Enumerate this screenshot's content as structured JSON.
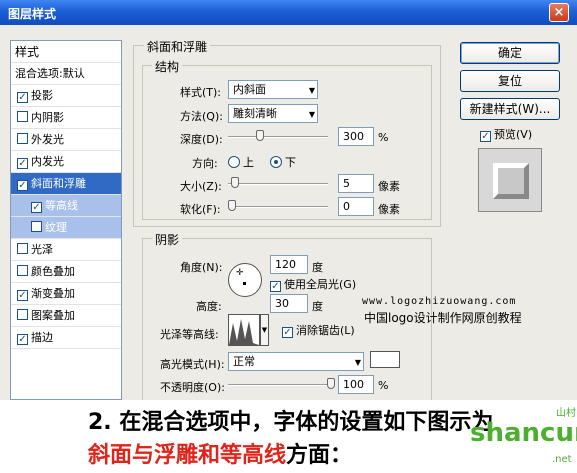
{
  "window": {
    "title": "图层样式",
    "close_glyph": "×"
  },
  "sidebar": {
    "header": "样式",
    "blend": "混合选项:默认",
    "items": [
      {
        "label": "投影",
        "checked": true
      },
      {
        "label": "内阴影",
        "checked": false
      },
      {
        "label": "外发光",
        "checked": false
      },
      {
        "label": "内发光",
        "checked": true
      },
      {
        "label": "斜面和浮雕",
        "checked": true
      },
      {
        "label": "等高线",
        "checked": true
      },
      {
        "label": "纹理",
        "checked": false
      },
      {
        "label": "光泽",
        "checked": false
      },
      {
        "label": "颜色叠加",
        "checked": false
      },
      {
        "label": "渐变叠加",
        "checked": true
      },
      {
        "label": "图案叠加",
        "checked": false
      },
      {
        "label": "描边",
        "checked": true
      }
    ]
  },
  "bevel": {
    "title": "斜面和浮雕",
    "structure_title": "结构",
    "style_label": "样式(T):",
    "style_value": "内斜面",
    "technique_label": "方法(Q):",
    "technique_value": "雕刻清晰",
    "depth_label": "深度(D):",
    "depth_value": "300",
    "depth_unit": "%",
    "depth_level": 0.3,
    "direction_label": "方向:",
    "dir_up": "上",
    "dir_down": "下",
    "size_label": "大小(Z):",
    "size_value": "5",
    "size_unit": "像素",
    "soften_label": "软化(F):",
    "soften_value": "0",
    "soften_unit": "像素"
  },
  "shading": {
    "title": "阴影",
    "angle_label": "角度(N):",
    "angle_value": "120",
    "angle_unit": "度",
    "global_light": "使用全局光(G)",
    "altitude_label": "高度:",
    "altitude_value": "30",
    "altitude_unit": "度",
    "gloss_label": "光泽等高线:",
    "antialias": "消除锯齿(L)",
    "highlight_label": "高光模式(H):",
    "highlight_value": "正常",
    "opacity_label": "不透明度(O):",
    "opacity_value": "100",
    "opacity_unit": "%"
  },
  "buttons": {
    "ok": "确定",
    "reset": "复位",
    "new_style": "新建样式(W)...",
    "preview": "预览(V)"
  },
  "watermark": {
    "url": "www.logozhizuowang.com",
    "text": "中国logo设计制作网原创教程"
  },
  "caption": {
    "line1": "2. 在混合选项中，字体的设置如下图示为",
    "line2_red": "斜面与浮雕和等高线",
    "line2_black": "方面："
  },
  "logo": {
    "text": "shancun",
    "sub": "山村",
    "net": ".net"
  },
  "colors": {
    "title_bar": "#1d5fd6",
    "selection": "#316ac5",
    "caption_red": "#e0241b",
    "logo_green": "#4caf2f"
  }
}
